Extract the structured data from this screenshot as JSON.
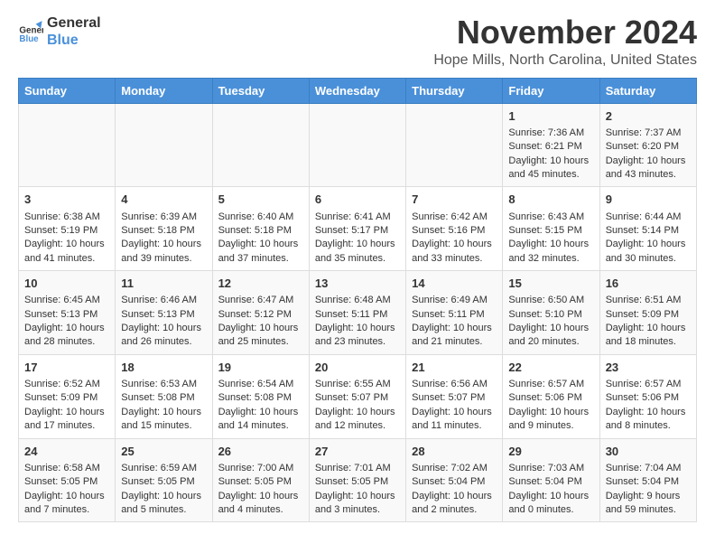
{
  "logo": {
    "line1": "General",
    "line2": "Blue"
  },
  "title": "November 2024",
  "location": "Hope Mills, North Carolina, United States",
  "weekdays": [
    "Sunday",
    "Monday",
    "Tuesday",
    "Wednesday",
    "Thursday",
    "Friday",
    "Saturday"
  ],
  "weeks": [
    [
      {
        "day": "",
        "info": ""
      },
      {
        "day": "",
        "info": ""
      },
      {
        "day": "",
        "info": ""
      },
      {
        "day": "",
        "info": ""
      },
      {
        "day": "",
        "info": ""
      },
      {
        "day": "1",
        "info": "Sunrise: 7:36 AM\nSunset: 6:21 PM\nDaylight: 10 hours and 45 minutes."
      },
      {
        "day": "2",
        "info": "Sunrise: 7:37 AM\nSunset: 6:20 PM\nDaylight: 10 hours and 43 minutes."
      }
    ],
    [
      {
        "day": "3",
        "info": "Sunrise: 6:38 AM\nSunset: 5:19 PM\nDaylight: 10 hours and 41 minutes."
      },
      {
        "day": "4",
        "info": "Sunrise: 6:39 AM\nSunset: 5:18 PM\nDaylight: 10 hours and 39 minutes."
      },
      {
        "day": "5",
        "info": "Sunrise: 6:40 AM\nSunset: 5:18 PM\nDaylight: 10 hours and 37 minutes."
      },
      {
        "day": "6",
        "info": "Sunrise: 6:41 AM\nSunset: 5:17 PM\nDaylight: 10 hours and 35 minutes."
      },
      {
        "day": "7",
        "info": "Sunrise: 6:42 AM\nSunset: 5:16 PM\nDaylight: 10 hours and 33 minutes."
      },
      {
        "day": "8",
        "info": "Sunrise: 6:43 AM\nSunset: 5:15 PM\nDaylight: 10 hours and 32 minutes."
      },
      {
        "day": "9",
        "info": "Sunrise: 6:44 AM\nSunset: 5:14 PM\nDaylight: 10 hours and 30 minutes."
      }
    ],
    [
      {
        "day": "10",
        "info": "Sunrise: 6:45 AM\nSunset: 5:13 PM\nDaylight: 10 hours and 28 minutes."
      },
      {
        "day": "11",
        "info": "Sunrise: 6:46 AM\nSunset: 5:13 PM\nDaylight: 10 hours and 26 minutes."
      },
      {
        "day": "12",
        "info": "Sunrise: 6:47 AM\nSunset: 5:12 PM\nDaylight: 10 hours and 25 minutes."
      },
      {
        "day": "13",
        "info": "Sunrise: 6:48 AM\nSunset: 5:11 PM\nDaylight: 10 hours and 23 minutes."
      },
      {
        "day": "14",
        "info": "Sunrise: 6:49 AM\nSunset: 5:11 PM\nDaylight: 10 hours and 21 minutes."
      },
      {
        "day": "15",
        "info": "Sunrise: 6:50 AM\nSunset: 5:10 PM\nDaylight: 10 hours and 20 minutes."
      },
      {
        "day": "16",
        "info": "Sunrise: 6:51 AM\nSunset: 5:09 PM\nDaylight: 10 hours and 18 minutes."
      }
    ],
    [
      {
        "day": "17",
        "info": "Sunrise: 6:52 AM\nSunset: 5:09 PM\nDaylight: 10 hours and 17 minutes."
      },
      {
        "day": "18",
        "info": "Sunrise: 6:53 AM\nSunset: 5:08 PM\nDaylight: 10 hours and 15 minutes."
      },
      {
        "day": "19",
        "info": "Sunrise: 6:54 AM\nSunset: 5:08 PM\nDaylight: 10 hours and 14 minutes."
      },
      {
        "day": "20",
        "info": "Sunrise: 6:55 AM\nSunset: 5:07 PM\nDaylight: 10 hours and 12 minutes."
      },
      {
        "day": "21",
        "info": "Sunrise: 6:56 AM\nSunset: 5:07 PM\nDaylight: 10 hours and 11 minutes."
      },
      {
        "day": "22",
        "info": "Sunrise: 6:57 AM\nSunset: 5:06 PM\nDaylight: 10 hours and 9 minutes."
      },
      {
        "day": "23",
        "info": "Sunrise: 6:57 AM\nSunset: 5:06 PM\nDaylight: 10 hours and 8 minutes."
      }
    ],
    [
      {
        "day": "24",
        "info": "Sunrise: 6:58 AM\nSunset: 5:05 PM\nDaylight: 10 hours and 7 minutes."
      },
      {
        "day": "25",
        "info": "Sunrise: 6:59 AM\nSunset: 5:05 PM\nDaylight: 10 hours and 5 minutes."
      },
      {
        "day": "26",
        "info": "Sunrise: 7:00 AM\nSunset: 5:05 PM\nDaylight: 10 hours and 4 minutes."
      },
      {
        "day": "27",
        "info": "Sunrise: 7:01 AM\nSunset: 5:05 PM\nDaylight: 10 hours and 3 minutes."
      },
      {
        "day": "28",
        "info": "Sunrise: 7:02 AM\nSunset: 5:04 PM\nDaylight: 10 hours and 2 minutes."
      },
      {
        "day": "29",
        "info": "Sunrise: 7:03 AM\nSunset: 5:04 PM\nDaylight: 10 hours and 0 minutes."
      },
      {
        "day": "30",
        "info": "Sunrise: 7:04 AM\nSunset: 5:04 PM\nDaylight: 9 hours and 59 minutes."
      }
    ]
  ]
}
